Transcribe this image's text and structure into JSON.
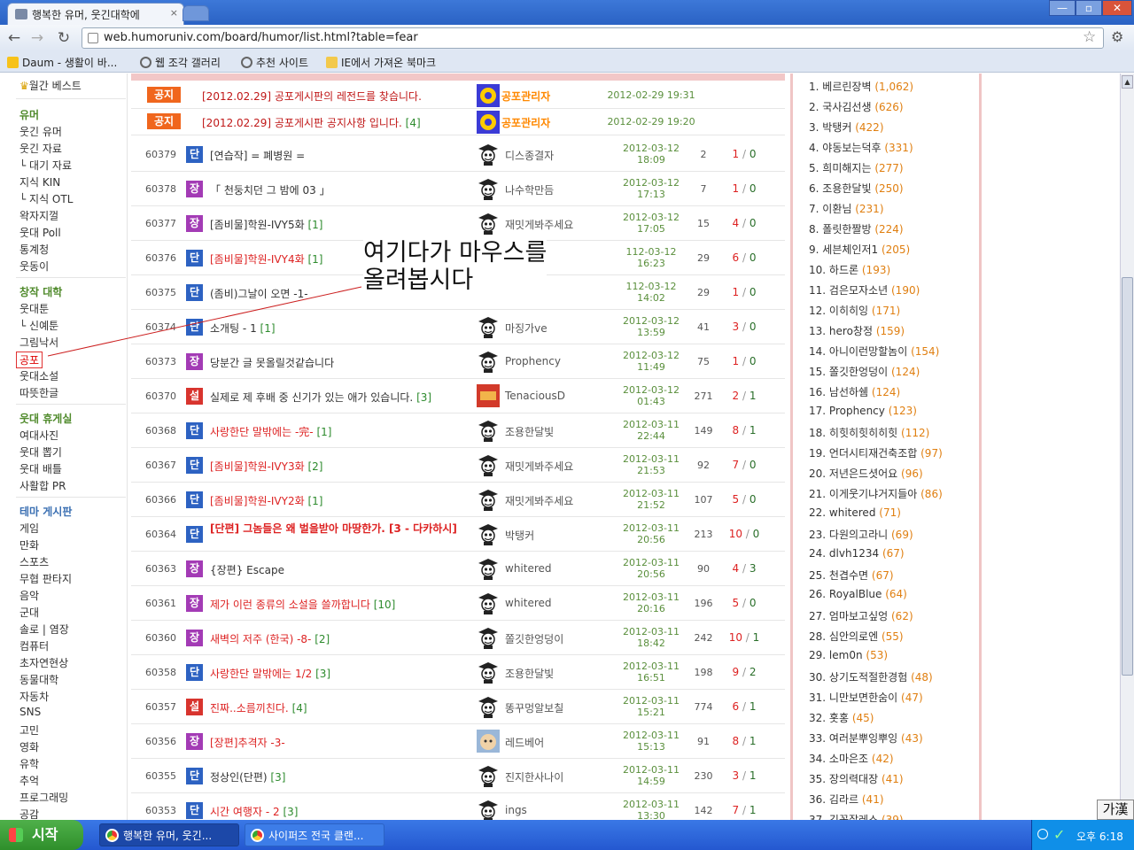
{
  "browser": {
    "tab_title": "행복한 유머, 웃긴대학에 ",
    "tab_close": "×",
    "url": "web.humoruniv.com/board/humor/list.html?table=fear",
    "min": "—",
    "max": "▫",
    "close": "✕",
    "back": "←",
    "forward": "→",
    "reload": "↻",
    "star": "☆",
    "wrench": "🔧",
    "bookmarks": [
      {
        "label": "Daum - 생활이 바..."
      },
      {
        "label": "웹 조각 갤러리"
      },
      {
        "label": "추천 사이트"
      },
      {
        "label": "IE에서 가져온 북마크"
      }
    ]
  },
  "leftnav": {
    "monthly_best": "월간 베스트",
    "humor_header": "유머",
    "humor_items": [
      "웃긴 유머",
      "웃긴 자료",
      "└ 대기 자료",
      "지식 KIN",
      "└ 지식 OTL",
      "왁자지껄",
      "웃대 Poll",
      "통계청",
      "웃동이"
    ],
    "creative_header": "창작 대학",
    "creative_items": [
      "웃대툰",
      "└ 신예툰",
      "그림낙서",
      "공포",
      "웃대소설",
      "따뜻한글"
    ],
    "lounge_header": "웃대 휴게실",
    "lounge_items": [
      "여대사진",
      "웃대 뽑기",
      "웃대 배틀",
      "사활합 PR"
    ],
    "theme_header": "테마 게시판",
    "theme_items": [
      "게임",
      "만화",
      "스포츠",
      "무협 판타지",
      "음악",
      "군대",
      "솔로 | 염장",
      "컴퓨터",
      "초자연현상",
      "동물대학",
      "자동차",
      "SNS",
      "고민",
      "영화",
      "유학",
      "추억",
      "프로그래밍",
      "공감"
    ]
  },
  "board": {
    "notices": [
      {
        "badge": "공지",
        "title": "[2012.02.29] 공포게시판의 레전드를 찾습니다.",
        "comments": "",
        "author": "공포관리자",
        "date": "2012-02-29 19:31"
      },
      {
        "badge": "공지",
        "title": "[2012.02.29] 공포게시판 공지사항 입니다.",
        "comments": "[4]",
        "author": "공포관리자",
        "date": "2012-02-29 19:20"
      }
    ],
    "posts": [
      {
        "num": "60379",
        "badge": "단",
        "title": "[연습작] = 폐병원 =",
        "comments": "",
        "author": "디스종결자",
        "date1": "2012-03-12",
        "date2": "18:09",
        "hits": "2",
        "rec": "1",
        "opp": "0",
        "red": false
      },
      {
        "num": "60378",
        "badge": "장",
        "title": "「 천둥치던 그 밤에 03 」",
        "comments": "",
        "author": "나수학만듬",
        "date1": "2012-03-12",
        "date2": "17:13",
        "hits": "7",
        "rec": "1",
        "opp": "0",
        "red": false
      },
      {
        "num": "60377",
        "badge": "장",
        "title": "[좀비물]학원-IVY5화",
        "comments": "[1]",
        "author": "재밋게봐주세요",
        "date1": "2012-03-12",
        "date2": "17:05",
        "hits": "15",
        "rec": "4",
        "opp": "0",
        "red": false
      },
      {
        "num": "60376",
        "badge": "단",
        "title": "[좀비물]학원-IVY4화",
        "comments": "[1]",
        "author": "",
        "date1": "112-03-12",
        "date2": "16:23",
        "hits": "29",
        "rec": "6",
        "opp": "0",
        "red": true
      },
      {
        "num": "60375",
        "badge": "단",
        "title": "(좀비)그날이 오면 -1-",
        "comments": "",
        "author": "",
        "date1": "112-03-12",
        "date2": "14:02",
        "hits": "29",
        "rec": "1",
        "opp": "0",
        "red": false
      },
      {
        "num": "60374",
        "badge": "단",
        "title": "소개팅 - 1",
        "comments": "[1]",
        "author": "마징가ve",
        "date1": "2012-03-12",
        "date2": "13:59",
        "hits": "41",
        "rec": "3",
        "opp": "0",
        "red": false
      },
      {
        "num": "60373",
        "badge": "장",
        "title": "당분간 글 못올릴것같습니다",
        "comments": "",
        "author": "Prophency",
        "date1": "2012-03-12",
        "date2": "11:49",
        "hits": "75",
        "rec": "1",
        "opp": "0",
        "red": false
      },
      {
        "num": "60370",
        "badge": "설",
        "title": "실제로 제 후배 중 신기가 있는 애가 있습니다.",
        "comments": "[3]",
        "author": "TenaciousD",
        "date1": "2012-03-12",
        "date2": "01:43",
        "hits": "271",
        "rec": "2",
        "opp": "1",
        "red": false
      },
      {
        "num": "60368",
        "badge": "단",
        "title": "사랑한단 말밖에는 -完-",
        "comments": "[1]",
        "author": "조용한달빛",
        "date1": "2012-03-11",
        "date2": "22:44",
        "hits": "149",
        "rec": "8",
        "opp": "1",
        "red": true
      },
      {
        "num": "60367",
        "badge": "단",
        "title": "[좀비물]학원-IVY3화",
        "comments": "[2]",
        "author": "재밋게봐주세요",
        "date1": "2012-03-11",
        "date2": "21:53",
        "hits": "92",
        "rec": "7",
        "opp": "0",
        "red": true
      },
      {
        "num": "60366",
        "badge": "단",
        "title": "[좀비물]학원-IVY2화",
        "comments": "[1]",
        "author": "재밋게봐주세요",
        "date1": "2012-03-11",
        "date2": "21:52",
        "hits": "107",
        "rec": "5",
        "opp": "0",
        "red": true
      },
      {
        "num": "60364",
        "badge": "단",
        "title": "[단편] 그놈들은 왜 벌을받아 마땅한가. [3 - 다카하시]",
        "comments": "",
        "author": "박탱커",
        "date1": "2012-03-11",
        "date2": "20:56",
        "hits": "213",
        "rec": "10",
        "opp": "0",
        "red": true,
        "bold": true
      },
      {
        "num": "60363",
        "badge": "장",
        "title": "{장편} Escape",
        "comments": "",
        "author": "whitered",
        "date1": "2012-03-11",
        "date2": "20:56",
        "hits": "90",
        "rec": "4",
        "opp": "3",
        "red": false
      },
      {
        "num": "60361",
        "badge": "장",
        "title": "제가 이런 종류의 소설을 쓸까합니다",
        "comments": "[10]",
        "author": "whitered",
        "date1": "2012-03-11",
        "date2": "20:16",
        "hits": "196",
        "rec": "5",
        "opp": "0",
        "red": true
      },
      {
        "num": "60360",
        "badge": "장",
        "title": "새벽의 저주 (한국) -8-",
        "comments": "[2]",
        "author": "쫄깃한엉덩이",
        "date1": "2012-03-11",
        "date2": "18:42",
        "hits": "242",
        "rec": "10",
        "opp": "1",
        "red": true
      },
      {
        "num": "60358",
        "badge": "단",
        "title": "사랑한단 말밖에는 1/2",
        "comments": "[3]",
        "author": "조용한달빛",
        "date1": "2012-03-11",
        "date2": "16:51",
        "hits": "198",
        "rec": "9",
        "opp": "2",
        "red": true
      },
      {
        "num": "60357",
        "badge": "설",
        "title": "진짜..소름끼친다.",
        "comments": "[4]",
        "author": "똥꾸멍알보칠",
        "date1": "2012-03-11",
        "date2": "15:21",
        "hits": "774",
        "rec": "6",
        "opp": "1",
        "red": true
      },
      {
        "num": "60356",
        "badge": "장",
        "title": "[장편]추격자 -3-",
        "comments": "",
        "author": "레드베어",
        "date1": "2012-03-11",
        "date2": "15:13",
        "hits": "91",
        "rec": "8",
        "opp": "1",
        "red": true
      },
      {
        "num": "60355",
        "badge": "단",
        "title": "정상인(단편)",
        "comments": "[3]",
        "author": "진지한사나이",
        "date1": "2012-03-11",
        "date2": "14:59",
        "hits": "230",
        "rec": "3",
        "opp": "1",
        "red": false
      },
      {
        "num": "60353",
        "badge": "단",
        "title": "시간 여행자 - 2",
        "comments": "[3]",
        "author": "ings",
        "date1": "2012-03-11",
        "date2": "13:30",
        "hits": "142",
        "rec": "7",
        "opp": "1",
        "red": true
      }
    ]
  },
  "overlay": {
    "line1": "여기다가 마우스를",
    "line2": "올려봅시다"
  },
  "ranking": [
    {
      "rank": "1.",
      "name": "베르린장벽",
      "count": "(1,062)"
    },
    {
      "rank": "2.",
      "name": "국사김선생",
      "count": "(626)"
    },
    {
      "rank": "3.",
      "name": "박탱커",
      "count": "(422)"
    },
    {
      "rank": "4.",
      "name": "야동보는덕후",
      "count": "(331)"
    },
    {
      "rank": "5.",
      "name": "희미해지는",
      "count": "(277)"
    },
    {
      "rank": "6.",
      "name": "조용한달빛",
      "count": "(250)"
    },
    {
      "rank": "7.",
      "name": "이환님",
      "count": "(231)"
    },
    {
      "rank": "8.",
      "name": "폴릿한짤방",
      "count": "(224)"
    },
    {
      "rank": "9.",
      "name": "세븐체인저1",
      "count": "(205)"
    },
    {
      "rank": "10.",
      "name": "하드론",
      "count": "(193)"
    },
    {
      "rank": "11.",
      "name": "검은모자소년",
      "count": "(190)"
    },
    {
      "rank": "12.",
      "name": "이히히잉",
      "count": "(171)"
    },
    {
      "rank": "13.",
      "name": "hero창정",
      "count": "(159)"
    },
    {
      "rank": "14.",
      "name": "아니이런망할놈이",
      "count": "(154)"
    },
    {
      "rank": "15.",
      "name": "쫄깃한엉덩이",
      "count": "(124)"
    },
    {
      "rank": "16.",
      "name": "남선하쉠",
      "count": "(124)"
    },
    {
      "rank": "17.",
      "name": "Prophency",
      "count": "(123)"
    },
    {
      "rank": "18.",
      "name": "히힛히힛히히힛",
      "count": "(112)"
    },
    {
      "rank": "19.",
      "name": "언더시티재건축조합",
      "count": "(97)"
    },
    {
      "rank": "20.",
      "name": "저년은드셧어요",
      "count": "(96)"
    },
    {
      "rank": "21.",
      "name": "이게웃기냐거지들아",
      "count": "(86)"
    },
    {
      "rank": "22.",
      "name": "whitered",
      "count": "(71)"
    },
    {
      "rank": "23.",
      "name": "다원의고라니",
      "count": "(69)"
    },
    {
      "rank": "24.",
      "name": "dlvh1234",
      "count": "(67)"
    },
    {
      "rank": "25.",
      "name": "천겹수면",
      "count": "(67)"
    },
    {
      "rank": "26.",
      "name": "RoyalBlue",
      "count": "(64)"
    },
    {
      "rank": "27.",
      "name": "엄마보고싶엉",
      "count": "(62)"
    },
    {
      "rank": "28.",
      "name": "심안의로엔",
      "count": "(55)"
    },
    {
      "rank": "29.",
      "name": "lem0n",
      "count": "(53)"
    },
    {
      "rank": "30.",
      "name": "상기도적절한경험",
      "count": "(48)"
    },
    {
      "rank": "31.",
      "name": "니만보면한숨이",
      "count": "(47)"
    },
    {
      "rank": "32.",
      "name": "홋홍",
      "count": "(45)"
    },
    {
      "rank": "33.",
      "name": "여러분뿌잉뿌잉",
      "count": "(43)"
    },
    {
      "rank": "34.",
      "name": "소마은조",
      "count": "(42)"
    },
    {
      "rank": "35.",
      "name": "장의력대장",
      "count": "(41)"
    },
    {
      "rank": "36.",
      "name": "김라르",
      "count": "(41)"
    },
    {
      "rank": "37.",
      "name": "긴꼼잘레스",
      "count": "(39)"
    }
  ],
  "ime": "가漢",
  "taskbar": {
    "start": "시작",
    "tasks": [
      "행복한 유머, 웃긴...",
      "사이퍼즈 전국 클랜..."
    ],
    "clock": "오후 6:18"
  }
}
